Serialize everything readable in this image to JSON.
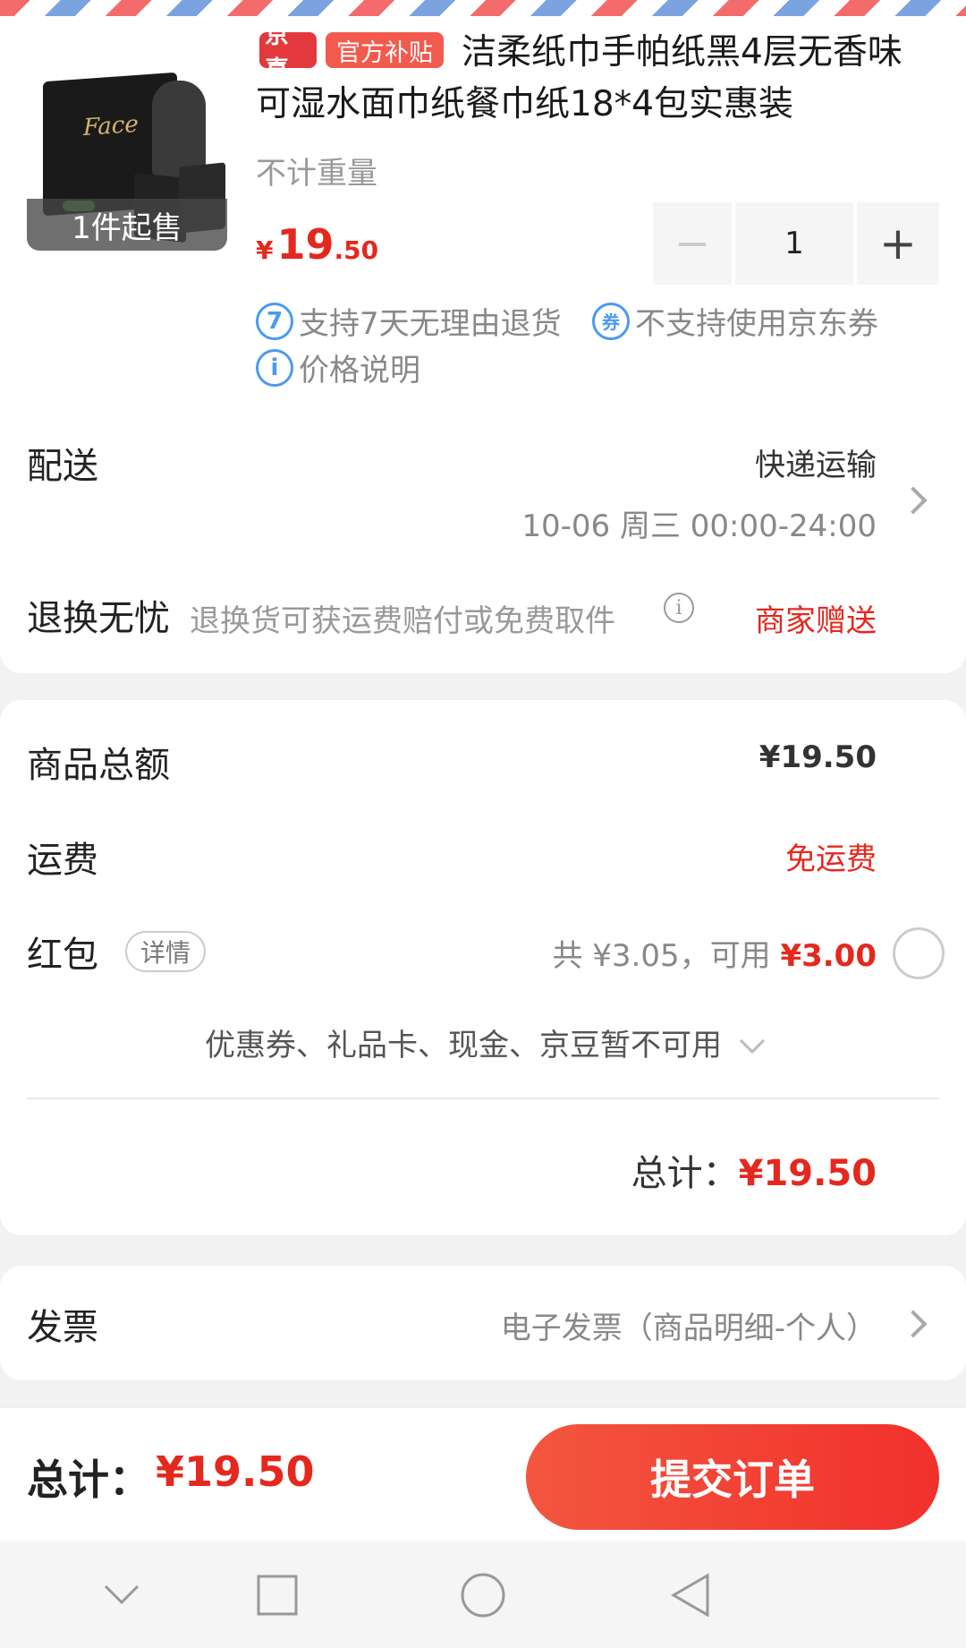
{
  "product": {
    "badge_jx": "京喜",
    "badge_subsidy": "官方补贴",
    "title": "洁柔纸巾手帕纸黑4层无香味可湿水面巾纸餐巾纸18*4包实惠装",
    "weight": "不计重量",
    "min_order": "1件起售",
    "thumb_brand": "Face",
    "price_symbol": "¥",
    "price_int": "19",
    "price_dec": ".50",
    "quantity": "1",
    "stepper_minus": "−",
    "stepper_plus": "+",
    "return_icon": "7",
    "return_policy": "支持7天无理由退货",
    "coupon_icon": "券",
    "coupon_policy": "不支持使用京东券",
    "price_info_icon": "i",
    "price_info": "价格说明"
  },
  "delivery": {
    "label": "配送",
    "method": "快递运输",
    "time": "10-06 周三 00:00-24:00"
  },
  "returns": {
    "label": "退换无忧",
    "desc": "退换货可获运费赔付或免费取件",
    "info_icon": "i",
    "status": "商家赠送"
  },
  "summary": {
    "goods_label": "商品总额",
    "goods_value": "¥19.50",
    "shipping_label": "运费",
    "shipping_value": "免运费",
    "redpacket_label": "红包",
    "redpacket_detail": "详情",
    "redpacket_total": "共 ¥3.05，可用",
    "redpacket_usable": "¥3.00",
    "unavailable": "优惠券、礼品卡、现金、京豆暂不可用",
    "total_label": "总计：",
    "total_value": "¥19.50"
  },
  "invoice": {
    "label": "发票",
    "value": "电子发票（商品明细-个人）"
  },
  "bottom_bar": {
    "total_label": "总计：",
    "total_value": "¥19.50",
    "submit_label": "提交订单"
  },
  "colors": {
    "accent_red": "#e4281e",
    "submit_gradient_start": "#f3563f",
    "icon_blue": "#4b9af0"
  },
  "icons": {
    "nav_back": "chevron-down-icon",
    "nav_home": "square-icon",
    "nav_circle": "circle-icon",
    "nav_triangle": "back-triangle-icon"
  }
}
